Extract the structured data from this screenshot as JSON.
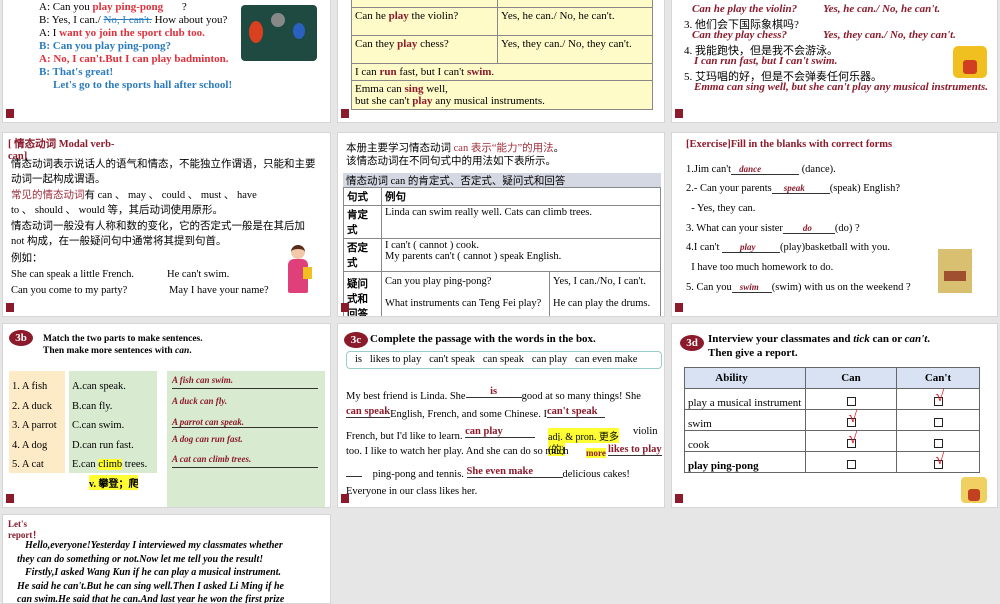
{
  "slide1": {
    "lines": [
      {
        "pre": "A: Can you ",
        "ans": "play ping-pong",
        "post": "?"
      },
      {
        "pre": "B: Yes, I can./ ",
        "strike": "No, I can't.",
        "post": " How about you?"
      },
      {
        "pre": "A: I ",
        "ans": "want yo join the sport club too."
      }
    ],
    "b1": "B: Can you play ping-pong?",
    "a2": "A: No, I can't.But I can play badminton.",
    "b3": "B: That's great!",
    "b4": "Let's go to the sports hall  after school!"
  },
  "slide2": {
    "rows": [
      {
        "q_pre": "Can he ",
        "q_verb": "play",
        "q_post": " the violin?",
        "a": "Yes, he can./ No, he can't."
      },
      {
        "q_pre": "Can they ",
        "q_verb": "play",
        "q_post": " chess?",
        "a": "Yes, they can./ No, they can't."
      }
    ],
    "r3": [
      "I can ",
      "run",
      " fast, but I can't ",
      "swim",
      "."
    ],
    "r4a": [
      "Emma can ",
      "sing",
      " well,"
    ],
    "r4b": [
      "but she can't ",
      "play",
      " any musical instruments."
    ]
  },
  "slide3": {
    "items": [
      {
        "cn": "",
        "en": "Can he play the violin?",
        "en2": "Yes, he can./ No, he can't."
      },
      {
        "cn": "3. 他们会下国际象棋吗?",
        "en": "Can they play chess?",
        "en2": "Yes, they can./ No, they can't."
      },
      {
        "cn": "4. 我能跑快，但是我不会游泳。",
        "en": "I can run fast, but I can't swim."
      },
      {
        "cn": "5. 艾玛唱的好，但是不会弹奏任何乐器。",
        "en": "Emma can sing well, but she can't play any musical instruments."
      }
    ]
  },
  "slide4": {
    "title": "[ 情态动词 Modal verb-can]",
    "p1": "情态动词表示说话人的语气和情态，不能独立作谓语，只能和主要动词一起构成谓语。",
    "p2_red": "常见的情态动词",
    "p2": "有 can 、 may 、 could 、 must 、 have to 、 should 、 would 等，其后动词使用原形。",
    "p3": "情态动词一般没有人称和数的变化，它的否定式一般是在其后加 not 构成，在一般疑问句中通常将其提到句首。",
    "eg": "例如：",
    "ex": [
      "She can speak a little French.",
      "He can't swim.",
      "Can you come to my party?",
      "May I have your name?"
    ]
  },
  "slide5": {
    "intro1a": "本册主要学习情态动词 ",
    "intro1b": "can 表示“能力”的用法",
    "intro1c": "。",
    "intro2": "该情态动词在不同句式中的用法如下表所示。",
    "caption": "情态动词  can 的肯定式、否定式、疑问式和回答",
    "h1": "句式",
    "h2": "例句",
    "aff": "肯定式",
    "aff_ex": "Linda can swim really well.      Cats can climb trees.",
    "neg": "否定式",
    "neg_ex1": "I can't ( cannot ) cook.",
    "neg_ex2": "My parents can't ( cannot ) speak English.",
    "q": "疑问式和回答",
    "q1": "Can you play ping-pong?",
    "a1": "Yes, I can./No, I can't.",
    "q2": "What instruments can Teng Fei play?",
    "a2": "He can play the drums."
  },
  "slide6": {
    "title": "[Exercise]Fill in the blanks with correct forms",
    "items": [
      {
        "pre": "1.Jim can't",
        "ans": "dance",
        "post": "(dance)."
      },
      {
        "pre": "2.- Can your parents",
        "ans": "speak",
        "post": "(speak) English?"
      },
      {
        "pre": "  - Yes, they can."
      },
      {
        "pre": "3. What can your sister",
        "ans": "do",
        "post": "(do) ?"
      },
      {
        "pre": "4.I can't ",
        "ans": "play",
        "post": "(play)basketball with you."
      },
      {
        "pre": "  I have too much homework to do."
      },
      {
        "pre": "5. Can you",
        "ans": "swim",
        "post": "(swim)  with us on the weekend ?"
      }
    ]
  },
  "slide7": {
    "badge": "3b",
    "inst1": "Match the two parts to make sentences.",
    "inst2a": "Then make more sentences with ",
    "inst2b": "can",
    "inst2c": ".",
    "left": [
      "1. A fish",
      "2. A duck",
      "3. A parrot",
      "4. A dog",
      "5. A cat"
    ],
    "right": [
      "A.can speak.",
      "B.can fly.",
      "C.can swim.",
      "D.can run fast."
    ],
    "e_pre": "E.can ",
    "e_hl": "climb",
    "e_post": " trees.",
    "note": "v. 攀登；爬",
    "answers": [
      "A fish can swim.",
      "A duck can fly.",
      "A parrot can speak.",
      "A dog can run fast.",
      "A cat can climb trees."
    ]
  },
  "slide8": {
    "badge": "3c",
    "title": "Complete the passage with the words in the box.",
    "words": "is   likes to play   can't speak   can speak   can play   can even make",
    "l1a": "My best friend is Linda. She",
    "l1ans": "is",
    "l1b": "good at so many things! She",
    "l2ans": "can speak",
    "l2b": "English, French, and some Chinese. I",
    "l2ans2": "can't speak",
    "l3a": "French, but I'd like to learn. ",
    "l3ans": "can play",
    "l3b": "violin",
    "note1": "adj. & pron. ",
    "note2": "更多",
    "note3": "(的)",
    "l4a": "too. I like to watch her play. And she can do so much ",
    "more": "more",
    "l4ans": "likes to play",
    "l5a": "ping-pong and tennis. ",
    "l5ans": "She even make",
    "l5b": "delicious cakes!",
    "l6": "Everyone in our class likes her."
  },
  "slide9": {
    "badge": "3d",
    "inst1a": "Interview your classmates and ",
    "tick": "tick",
    "inst1b": " can or ",
    "cant": "can't",
    "inst1c": ".",
    "inst2": "Then give a report.",
    "headers": [
      "Ability",
      "Can",
      "Can't"
    ],
    "rows": [
      {
        "ability": "play a musical instrument",
        "can": false
      },
      {
        "ability": "swim",
        "can": true
      },
      {
        "ability": "cook",
        "can": true
      },
      {
        "ability": "play ping-pong",
        "can": false
      }
    ]
  },
  "slide10": {
    "title": "Let's report！",
    "text": [
      "Hello,everyone!Yesterday I interviewed my classmates whether",
      "they can do something or not.Now let me tell you the result!",
      "Firstly,I asked Wang Kun if  he can play a musical instrument.",
      "He said he can't.But he can sing well.Then I asked Li Ming if he",
      "can swim.He said that he can.And last year he won the first prize"
    ]
  }
}
